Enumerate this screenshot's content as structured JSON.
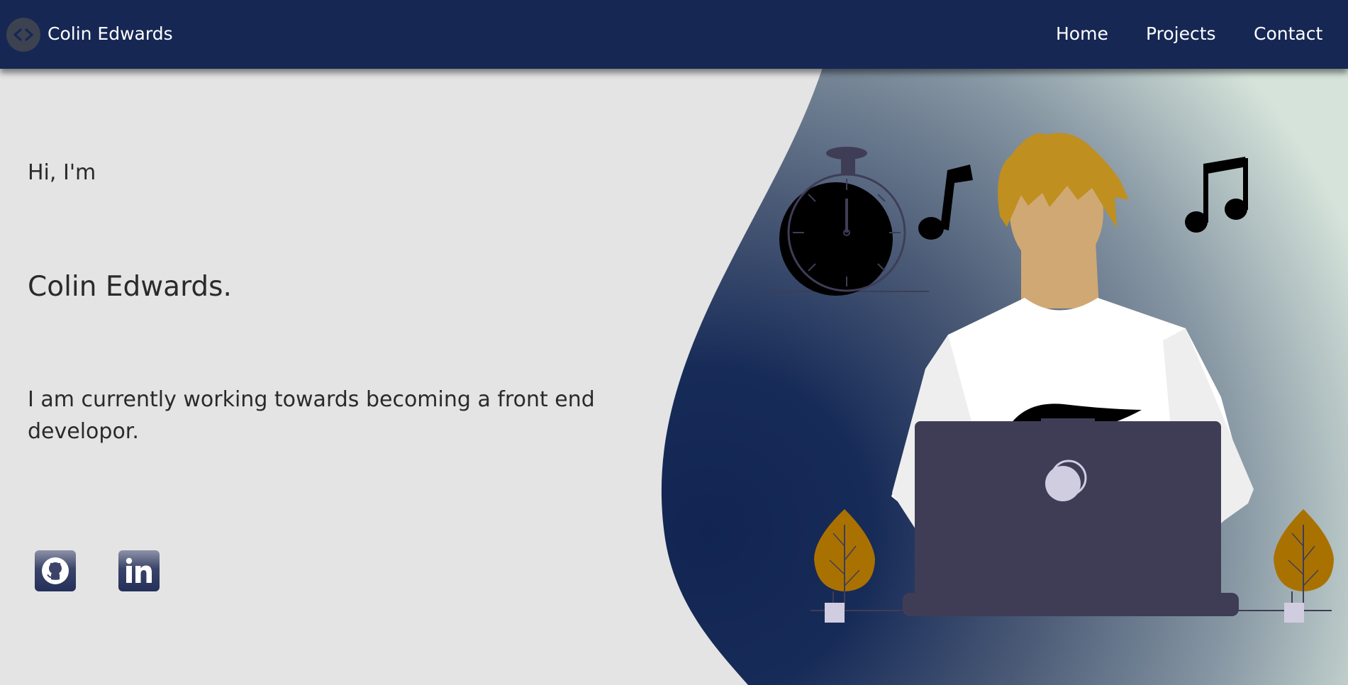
{
  "navbar": {
    "logo_icon": "code-brackets-icon",
    "brand": "Colin Edwards",
    "links": [
      {
        "label": "Home"
      },
      {
        "label": "Projects"
      },
      {
        "label": "Contact"
      }
    ]
  },
  "hero": {
    "greeting": "Hi, I'm",
    "name": "Colin Edwards.",
    "bio": "I am currently working towards becoming a front end developor.",
    "social": [
      {
        "icon": "github-icon"
      },
      {
        "icon": "linkedin-icon"
      }
    ]
  },
  "colors": {
    "navbar": "#162754",
    "page_background": "#e4e4e4",
    "blob_dark": "#122552",
    "blob_light": "#d4e2da",
    "text": "#2a2a2a",
    "accent_hair": "#bf8f20",
    "laptop": "#3f3d56"
  }
}
